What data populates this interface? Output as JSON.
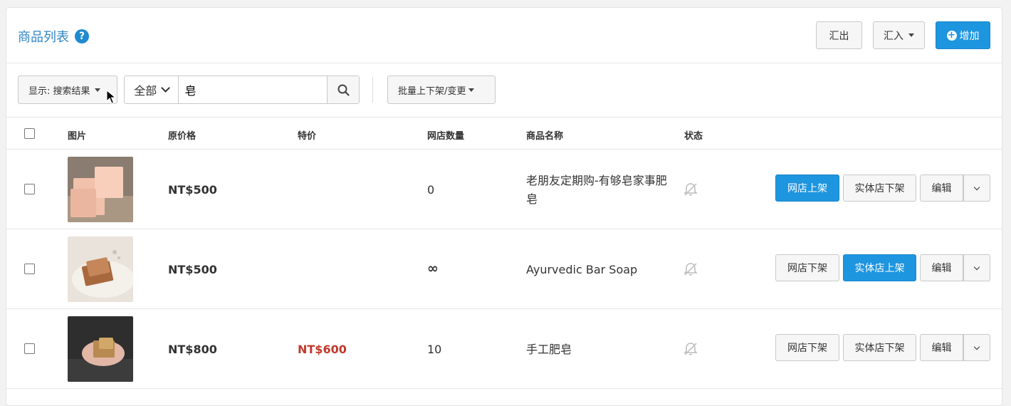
{
  "header": {
    "title": "商品列表",
    "help_icon": "?",
    "export_label": "汇出",
    "import_label": "汇入",
    "add_label": "增加",
    "add_icon": "+"
  },
  "toolbar": {
    "display_select": "显示: 搜索结果",
    "scope_select": "全部",
    "search_value": "皂",
    "bulk_label": "批量上下架/变更"
  },
  "table": {
    "columns": {
      "image": "图片",
      "original_price": "原价格",
      "special_price": "特价",
      "online_qty": "网店数量",
      "name": "商品名称",
      "status": "状态"
    },
    "rows": [
      {
        "original_price": "NT$500",
        "special_price": "",
        "online_qty": "0",
        "name": "老朋友定期购-有够皂家事肥皂",
        "online_btn": "网店上架",
        "online_btn_primary": true,
        "store_btn": "实体店下架",
        "store_btn_primary": false,
        "edit_label": "编辑"
      },
      {
        "original_price": "NT$500",
        "special_price": "",
        "online_qty": "∞",
        "name": "Ayurvedic Bar Soap",
        "online_btn": "网店下架",
        "online_btn_primary": false,
        "store_btn": "实体店上架",
        "store_btn_primary": true,
        "edit_label": "编辑"
      },
      {
        "original_price": "NT$800",
        "special_price": "NT$600",
        "online_qty": "10",
        "name": "手工肥皂",
        "online_btn": "网店下架",
        "online_btn_primary": false,
        "store_btn": "实体店下架",
        "store_btn_primary": false,
        "edit_label": "编辑"
      }
    ]
  },
  "colors": {
    "accent": "#1e95df",
    "title": "#2f86c8",
    "special_price": "#c0392b"
  }
}
